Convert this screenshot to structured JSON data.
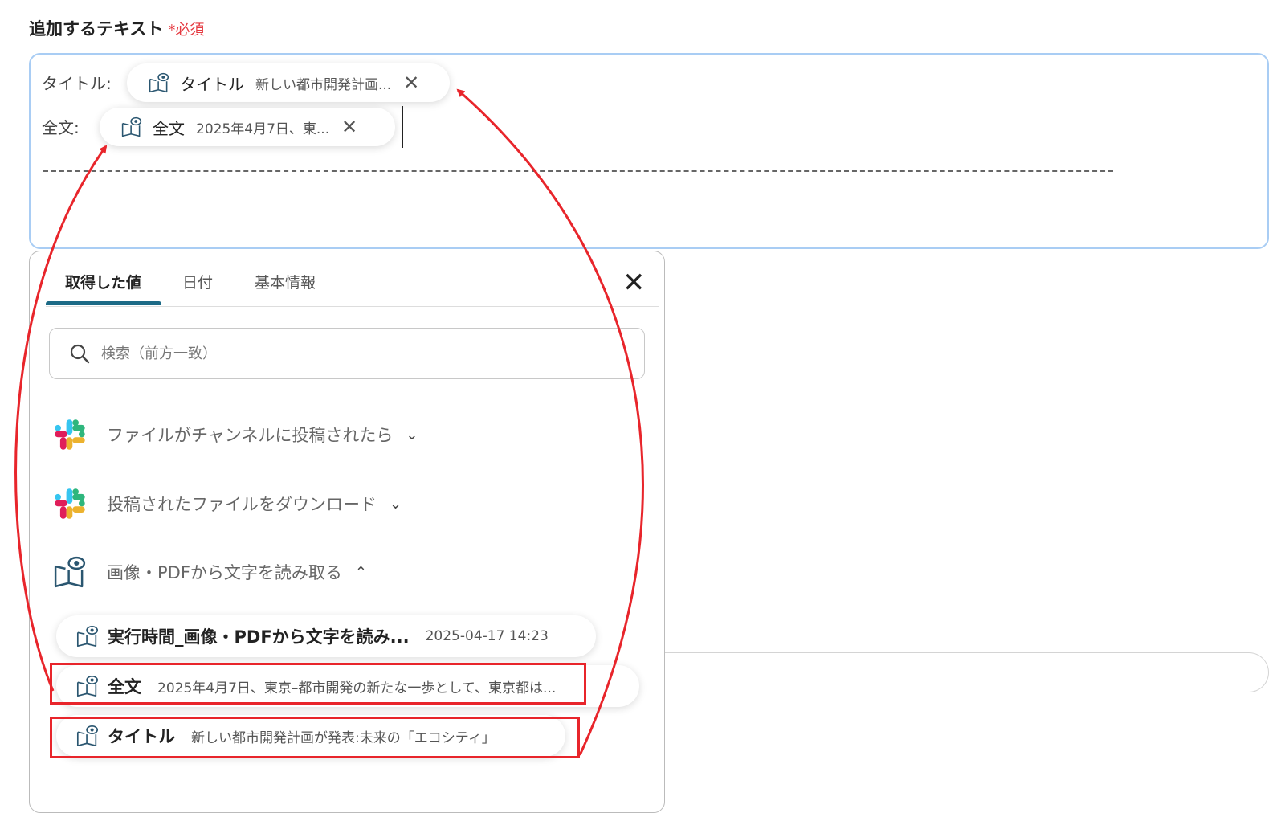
{
  "field": {
    "label": "追加するテキスト",
    "required_mark": "*",
    "required_text": "必須"
  },
  "editor": {
    "lines": [
      {
        "label": "タイトル:",
        "chip_name": "タイトル",
        "chip_value": "新しい都市開発計画..."
      },
      {
        "label": "全文:",
        "chip_name": "全文",
        "chip_value": "2025年4月7日、東..."
      }
    ]
  },
  "panel": {
    "tabs": [
      "取得した値",
      "日付",
      "基本情報"
    ],
    "active_tab": "取得した値",
    "search_placeholder": "検索（前方一致）",
    "sections": [
      {
        "title": "ファイルがチャンネルに投稿されたら",
        "icon": "slack-icon",
        "expanded": false
      },
      {
        "title": "投稿されたファイルをダウンロード",
        "icon": "slack-icon",
        "expanded": false
      },
      {
        "title": "画像・PDFから文字を読み取る",
        "icon": "ocr-book-eye-icon",
        "expanded": true
      }
    ],
    "items": [
      {
        "name": "実行時間_画像・PDFから文字を読み...",
        "value": "2025-04-17 14:23",
        "highlighted": false
      },
      {
        "name": "全文",
        "value": "2025年4月7日、東京–都市開発の新たな一歩として、東京都は...",
        "highlighted": true
      },
      {
        "name": "タイトル",
        "value": "新しい都市開発計画が発表:未来の「エコシティ」",
        "highlighted": true
      }
    ]
  },
  "colors": {
    "accent": "#1c6a86",
    "required": "#e53940",
    "annotation": "#e8252b",
    "focus_border": "#a9cdf4"
  }
}
